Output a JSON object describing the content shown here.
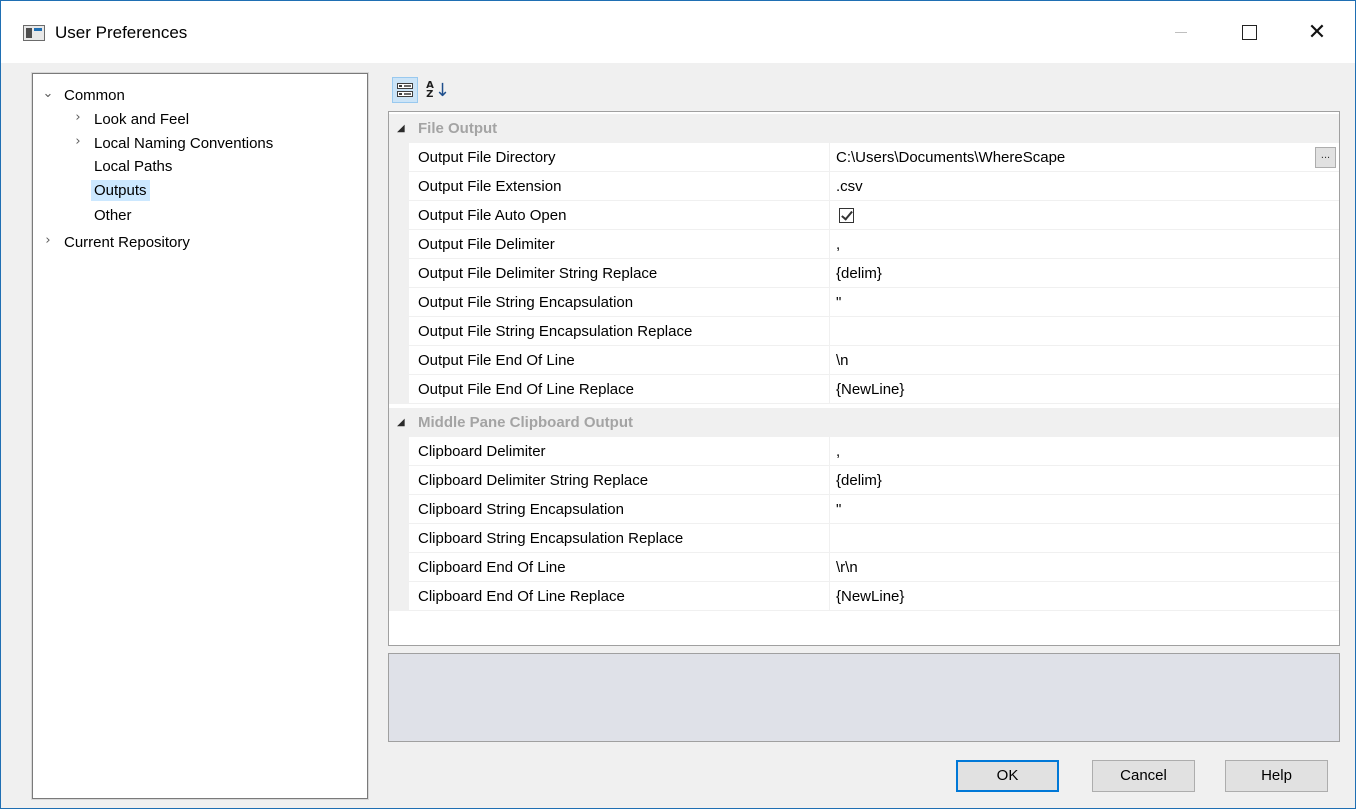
{
  "window": {
    "title": "User Preferences"
  },
  "tree": {
    "items": [
      {
        "label": "Common",
        "expanded": true,
        "level": 0
      },
      {
        "label": "Look and Feel",
        "expandable": true,
        "level": 1
      },
      {
        "label": "Local Naming Conventions",
        "expandable": true,
        "level": 1
      },
      {
        "label": "Local Paths",
        "level": 1
      },
      {
        "label": "Outputs",
        "level": 1,
        "selected": true
      },
      {
        "label": "Other",
        "level": 1
      },
      {
        "label": "Current Repository",
        "expandable": true,
        "level": 0
      }
    ]
  },
  "toolbar": {
    "categorized_icon": "categorized-icon",
    "alphabetical_icon": "sort-alphabetical-icon"
  },
  "grid": {
    "categories": [
      {
        "label": "File Output",
        "rows": [
          {
            "name": "Output File Directory",
            "value": "C:\\Users\\Documents\\WhereScape",
            "button": "..."
          },
          {
            "name": "Output File Extension",
            "value": ".csv"
          },
          {
            "name": "Output File Auto Open",
            "checked": true
          },
          {
            "name": "Output File Delimiter",
            "value": ","
          },
          {
            "name": "Output File Delimiter String Replace",
            "value": "{delim}"
          },
          {
            "name": "Output File String Encapsulation",
            "value": "\""
          },
          {
            "name": "Output File String Encapsulation Replace",
            "value": ""
          },
          {
            "name": "Output File End Of Line",
            "value": "\\n"
          },
          {
            "name": "Output File End Of Line Replace",
            "value": "{NewLine}"
          }
        ]
      },
      {
        "label": "Middle Pane Clipboard Output",
        "rows": [
          {
            "name": "Clipboard Delimiter",
            "value": ","
          },
          {
            "name": "Clipboard Delimiter String Replace",
            "value": "{delim}"
          },
          {
            "name": "Clipboard String Encapsulation",
            "value": "\""
          },
          {
            "name": "Clipboard String Encapsulation Replace",
            "value": ""
          },
          {
            "name": "Clipboard End Of Line",
            "value": "\\r\\n"
          },
          {
            "name": "Clipboard End Of Line Replace",
            "value": "{NewLine}"
          }
        ]
      }
    ]
  },
  "buttons": {
    "ok": "OK",
    "cancel": "Cancel",
    "help": "Help"
  }
}
